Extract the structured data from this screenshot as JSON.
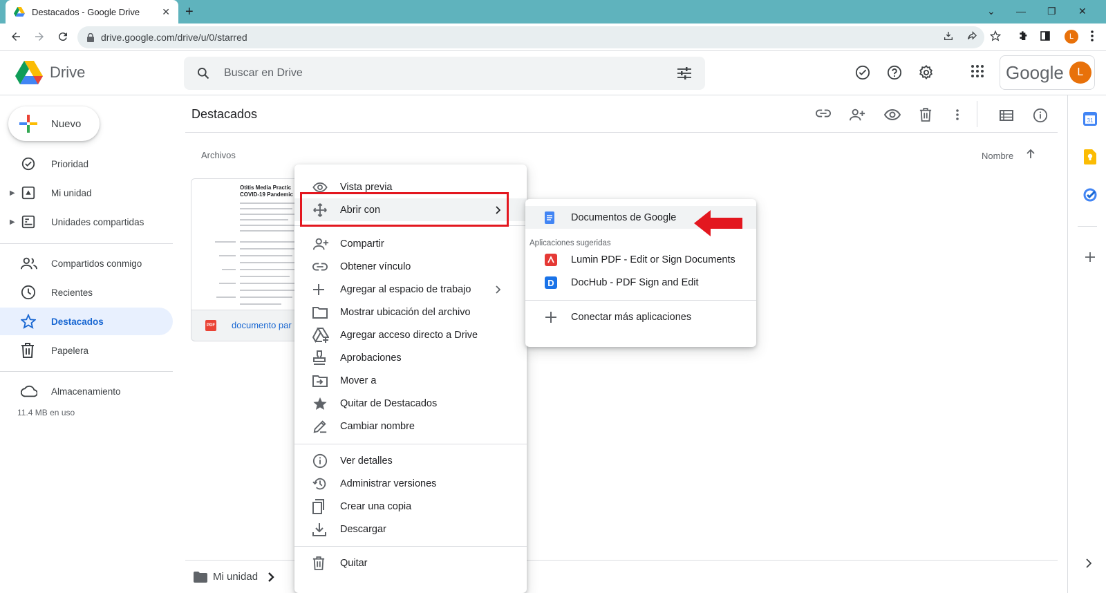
{
  "browser": {
    "tab_title": "Destacados - Google Drive",
    "url": "drive.google.com/drive/u/0/starred",
    "profile_initial": "L"
  },
  "header": {
    "app_name": "Drive",
    "search_placeholder": "Buscar en Drive",
    "google_word": "Google",
    "avatar_initial": "L"
  },
  "sidebar": {
    "new_button": "Nuevo",
    "items": [
      {
        "label": "Prioridad",
        "icon": "priority-icon"
      },
      {
        "label": "Mi unidad",
        "icon": "my-drive-icon"
      },
      {
        "label": "Unidades compartidas",
        "icon": "shared-drives-icon"
      },
      {
        "label": "Compartidos conmigo",
        "icon": "people-icon"
      },
      {
        "label": "Recientes",
        "icon": "clock-icon"
      },
      {
        "label": "Destacados",
        "icon": "star-icon",
        "active": true
      },
      {
        "label": "Papelera",
        "icon": "trash-icon"
      },
      {
        "label": "Almacenamiento",
        "icon": "cloud-icon"
      }
    ],
    "storage_used": "11.4 MB en uso"
  },
  "main": {
    "title": "Destacados",
    "section": "Archivos",
    "sort_label": "Nombre",
    "file": {
      "name": "documento par",
      "type_badge": "PDF",
      "thumb_title_1": "Otitis Media Practic",
      "thumb_title_2": "COVID-19 Pandemic"
    },
    "breadcrumb": {
      "root": "Mi unidad"
    }
  },
  "context_menu": {
    "items": [
      {
        "label": "Vista previa",
        "icon": "eye-icon"
      },
      {
        "label": "Abrir con",
        "icon": "move-arrows-icon",
        "has_submenu": true
      },
      {
        "label": "Compartir",
        "icon": "person-add-icon"
      },
      {
        "label": "Obtener vínculo",
        "icon": "link-icon"
      },
      {
        "label": "Agregar al espacio de trabajo",
        "icon": "plus-icon",
        "has_submenu": true
      },
      {
        "label": "Mostrar ubicación del archivo",
        "icon": "folder-icon"
      },
      {
        "label": "Agregar acceso directo a Drive",
        "icon": "drive-shortcut-icon"
      },
      {
        "label": "Aprobaciones",
        "icon": "stamp-icon"
      },
      {
        "label": "Mover a",
        "icon": "move-to-icon"
      },
      {
        "label": "Quitar de Destacados",
        "icon": "star-filled-icon"
      },
      {
        "label": "Cambiar nombre",
        "icon": "pencil-icon"
      },
      {
        "label": "Ver detalles",
        "icon": "info-icon"
      },
      {
        "label": "Administrar versiones",
        "icon": "history-icon"
      },
      {
        "label": "Crear una copia",
        "icon": "copy-icon"
      },
      {
        "label": "Descargar",
        "icon": "download-icon"
      },
      {
        "label": "Quitar",
        "icon": "trash-icon"
      }
    ]
  },
  "submenu": {
    "primary": "Documentos de Google",
    "suggested_heading": "Aplicaciones sugeridas",
    "apps": [
      "Lumin PDF - Edit or Sign Documents",
      "DocHub - PDF Sign and Edit"
    ],
    "connect": "Conectar más aplicaciones"
  },
  "colors": {
    "tabstrip": "#5fb3bd",
    "active_nav_bg": "#e8f0fe",
    "active_nav_fg": "#1967d2",
    "annotation_red": "#e3171f"
  }
}
